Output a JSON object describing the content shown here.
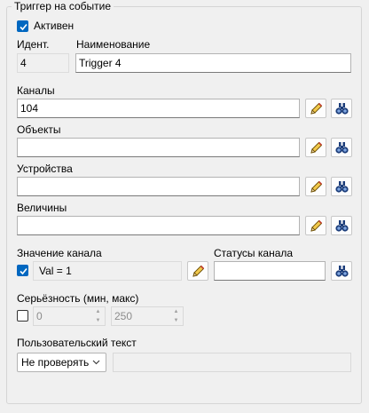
{
  "group": {
    "title": "Триггер на событие"
  },
  "active": {
    "label": "Активен",
    "checked": true
  },
  "ident": {
    "label": "Идент.",
    "value": "4"
  },
  "name": {
    "label": "Наименование",
    "value": "Trigger 4"
  },
  "channels": {
    "label": "Каналы",
    "value": "104"
  },
  "objects": {
    "label": "Объекты",
    "value": ""
  },
  "devices": {
    "label": "Устройства",
    "value": ""
  },
  "quantities": {
    "label": "Величины",
    "value": ""
  },
  "channel_value": {
    "label": "Значение канала",
    "value": "Val = 1",
    "checked": true
  },
  "channel_status": {
    "label": "Статусы канала",
    "value": ""
  },
  "severity": {
    "label": "Серьёзность (мин, макс)",
    "min": "0",
    "max": "250",
    "checked": false
  },
  "custom_text": {
    "label": "Пользовательский текст",
    "mode": "Не проверять",
    "value": ""
  },
  "icons": {
    "edit": "pencil-icon",
    "search": "binoculars-icon",
    "check": "checkmark-icon"
  }
}
